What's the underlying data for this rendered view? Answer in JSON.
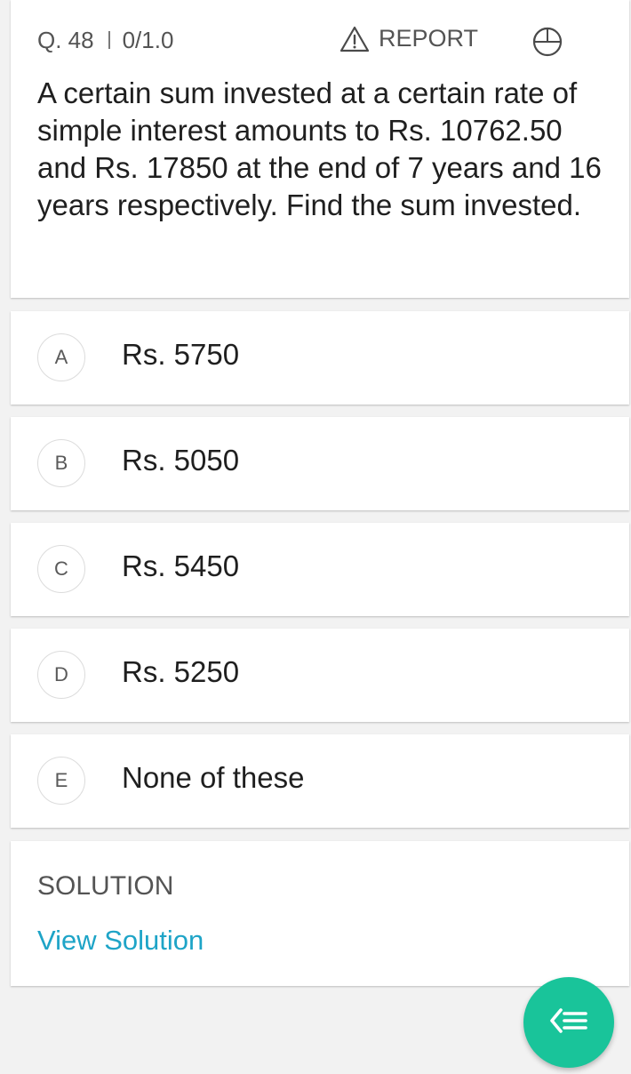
{
  "header": {
    "question_number": "Q. 48",
    "score": "0/1.0",
    "report_label": "REPORT",
    "report_icon": "warning-triangle-icon",
    "timer_icon": "timer-icon"
  },
  "question": {
    "text": "A certain sum invested at a certain rate of simple interest amounts to Rs. 10762.50 and Rs. 17850 at the end of 7 years and 16 years respectively. Find the sum invested."
  },
  "options": [
    {
      "letter": "A",
      "text": "Rs. 5750"
    },
    {
      "letter": "B",
      "text": "Rs. 5050"
    },
    {
      "letter": "C",
      "text": "Rs. 5450"
    },
    {
      "letter": "D",
      "text": "Rs. 5250"
    },
    {
      "letter": "E",
      "text": "None of these"
    }
  ],
  "solution": {
    "title": "SOLUTION",
    "link_label": "View Solution"
  },
  "fab": {
    "icon": "back-menu-icon",
    "color": "#19c49a"
  },
  "colors": {
    "link": "#1ea4c7",
    "background": "#f2f2f2"
  }
}
